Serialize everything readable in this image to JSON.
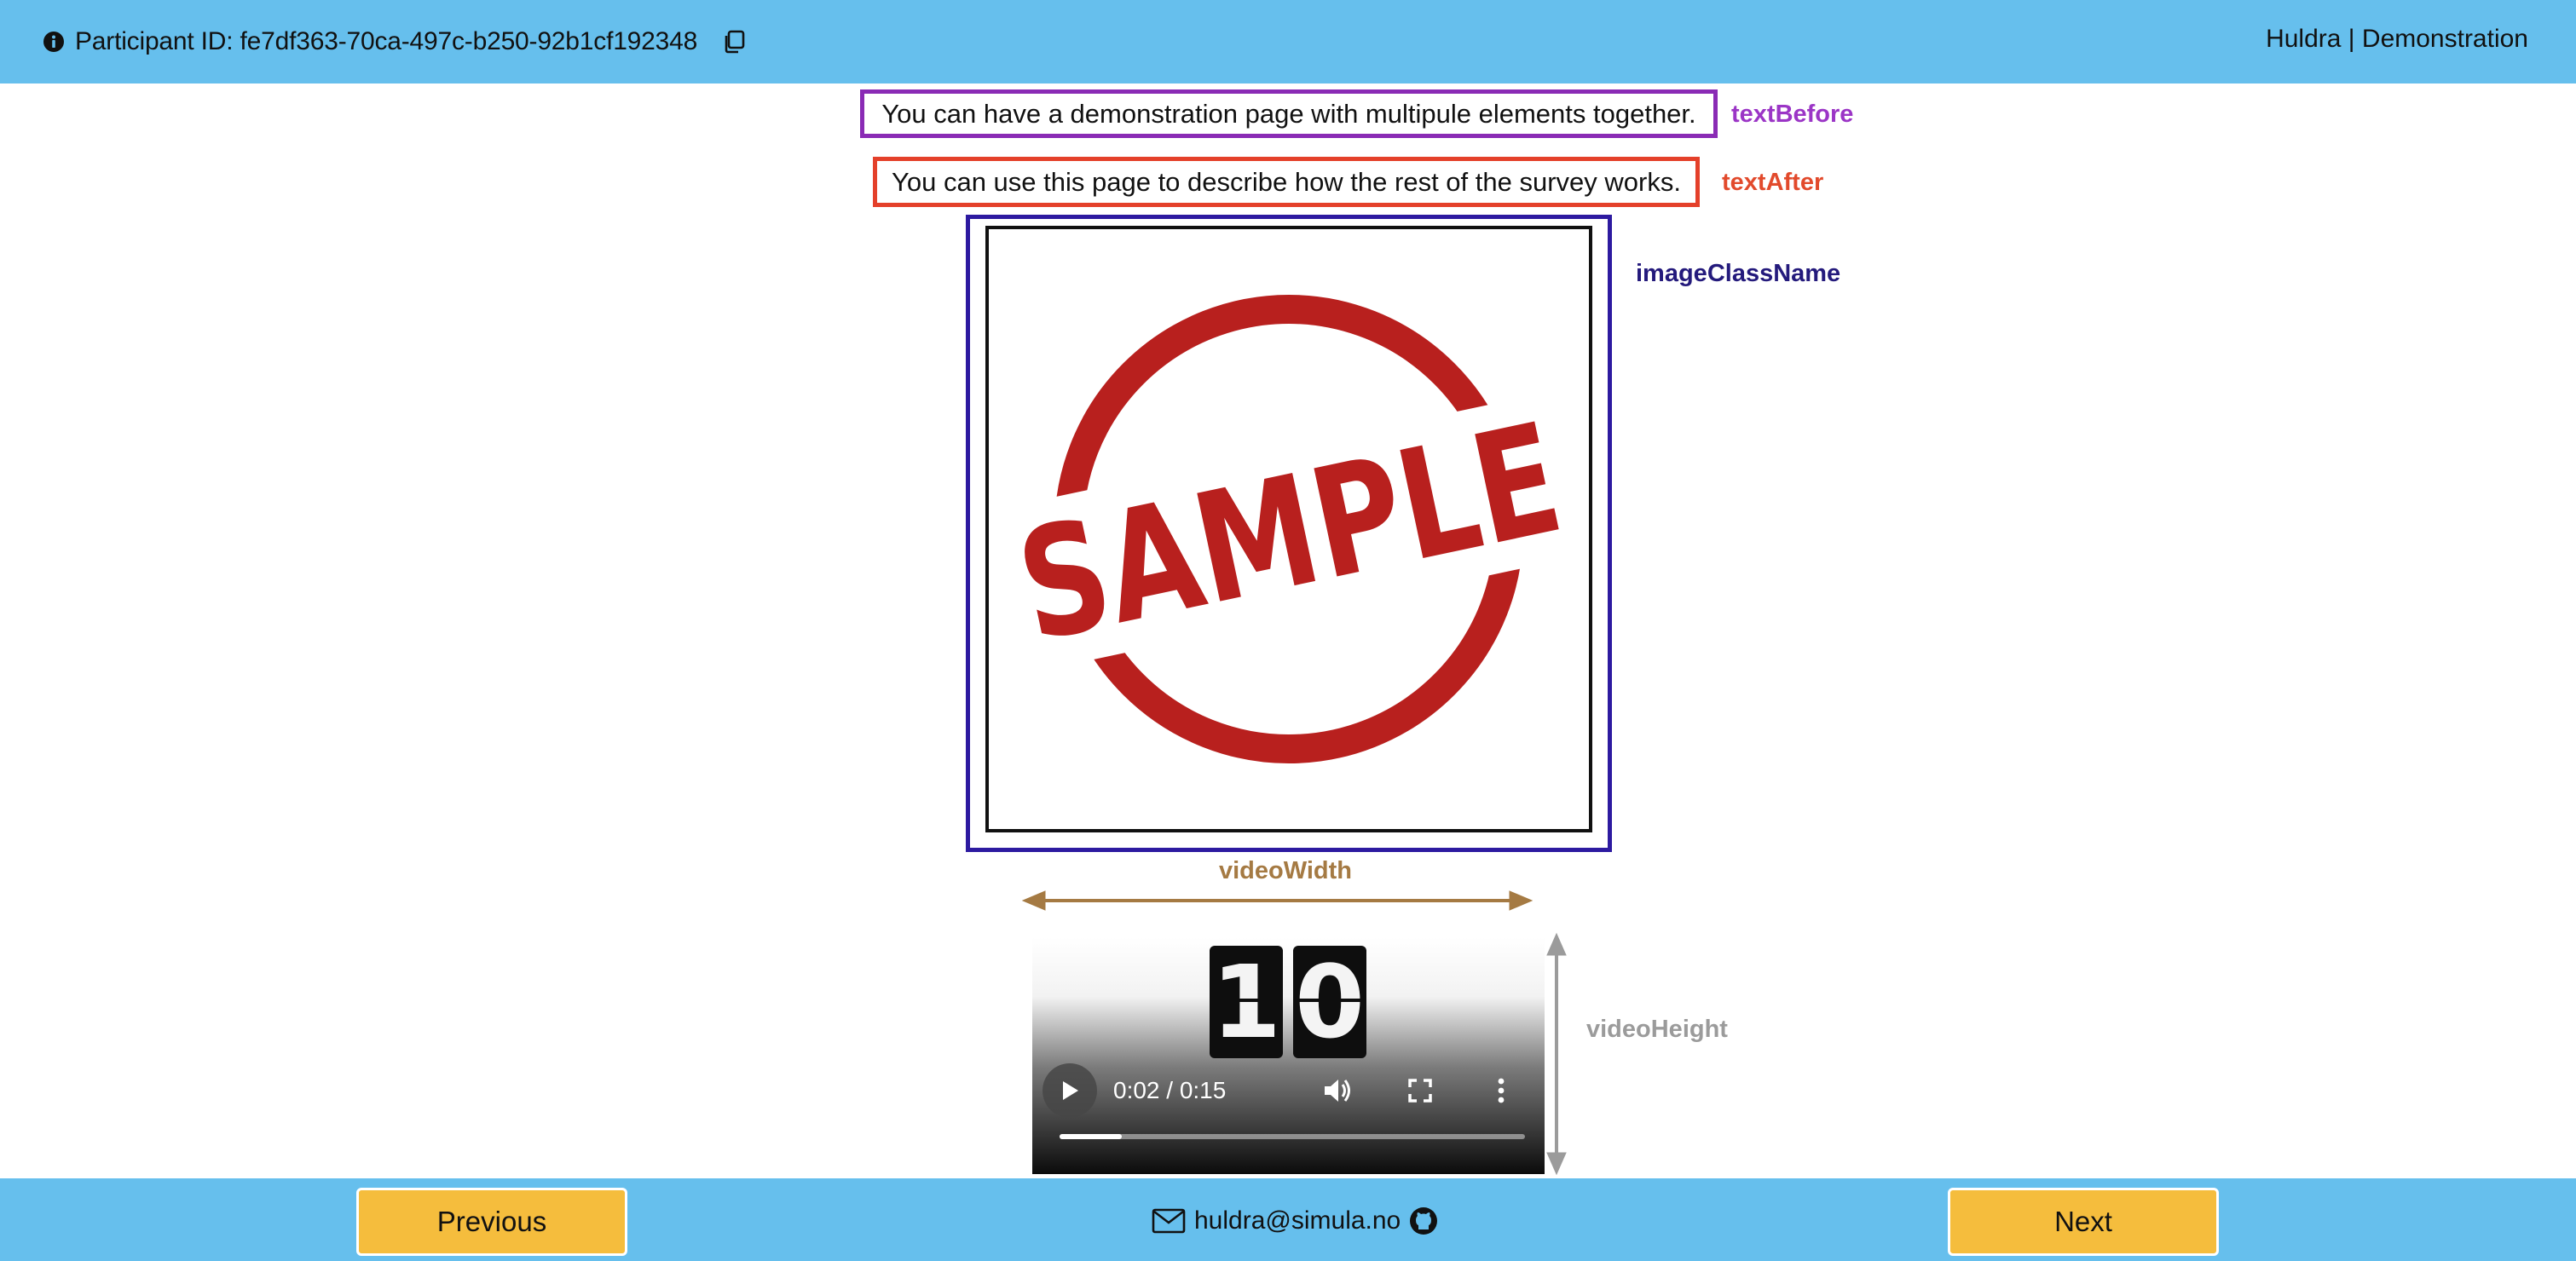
{
  "header": {
    "participant_label": "Participant ID: fe7df363-70ca-497c-b250-92b1cf192348",
    "app_title": "Huldra | Demonstration"
  },
  "main": {
    "text_before": "You can have a demonstration page with multipule elements together.",
    "text_after": "You can use this page to describe how the rest of the survey works.",
    "image_stamp_text": "SAMPLE",
    "annotations": {
      "text_before": "textBefore",
      "text_after": "textAfter",
      "image_class": "imageClassName",
      "video_width": "videoWidth",
      "video_height": "videoHeight"
    },
    "video": {
      "countdown_digit_1": "1",
      "countdown_digit_2": "0",
      "time_display": "0:02 / 0:15",
      "progress_fraction": 0.1333
    }
  },
  "footer": {
    "previous_label": "Previous",
    "next_label": "Next",
    "email": "huldra@simula.no"
  },
  "colors": {
    "bar_blue": "#66bfed",
    "button_yellow": "#f5bd3d",
    "text_before_border": "#8a2bb5",
    "text_after_border": "#e4402a",
    "image_border": "#2d1aa0",
    "video_width_arrow": "#a57a43",
    "video_height_arrow": "#9b9b9b",
    "stamp_red": "#b8201e"
  },
  "icons": {
    "info": "info-circle-icon",
    "copy": "copy-icon",
    "mail": "envelope-icon",
    "github": "github-icon",
    "play": "play-icon",
    "volume": "volume-icon",
    "fullscreen": "fullscreen-icon",
    "more": "more-vert-icon"
  }
}
